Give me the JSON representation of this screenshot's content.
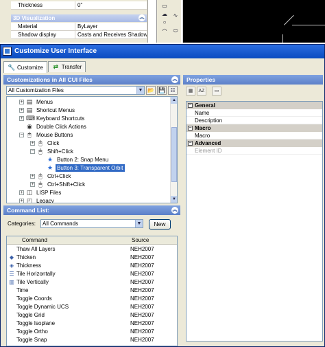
{
  "background": {
    "properties": [
      {
        "key": "Thickness",
        "value": "0\""
      },
      {
        "key": "Material",
        "value": "ByLayer"
      },
      {
        "key": "Shadow display",
        "value": "Casts and Receives Shadows"
      }
    ],
    "section_title": "3D Visualization",
    "tools": [
      "rectangle-icon",
      "cloud-icon",
      "circle-icon",
      "arc-icon",
      "spline-icon",
      "ellipse-icon"
    ]
  },
  "dialog": {
    "title": "Customize User Interface",
    "tabs": [
      {
        "label": "Customize",
        "icon": "wrench-icon",
        "active": true
      },
      {
        "label": "Transfer",
        "icon": "swap-arrows-icon",
        "active": false
      }
    ]
  },
  "customizations": {
    "header": "Customizations in All CUI Files",
    "combo_value": "All Customization Files",
    "tree": [
      {
        "label": "Menus",
        "icon": "menu-icon",
        "expander": "+",
        "indent": 0
      },
      {
        "label": "Shortcut Menus",
        "icon": "shortcut-menu-icon",
        "expander": "+",
        "indent": 0
      },
      {
        "label": "Keyboard Shortcuts",
        "icon": "keyboard-icon",
        "expander": "+",
        "indent": 0
      },
      {
        "label": "Double Click Actions",
        "icon": "double-click-icon",
        "expander": "",
        "indent": 0
      },
      {
        "label": "Mouse Buttons",
        "icon": "mouse-icon",
        "expander": "-",
        "indent": 0
      },
      {
        "label": "Click",
        "icon": "mouse-icon",
        "expander": "+",
        "indent": 1
      },
      {
        "label": "Shift+Click",
        "icon": "mouse-icon",
        "expander": "-",
        "indent": 1
      },
      {
        "label": "Button 2: Snap Menu",
        "icon": "star-icon",
        "expander": "",
        "indent": 2
      },
      {
        "label": "Button 3: Transparent Orbit",
        "icon": "star-icon",
        "expander": "",
        "indent": 2,
        "selected": true
      },
      {
        "label": "Ctrl+Click",
        "icon": "mouse-icon",
        "expander": "+",
        "indent": 1
      },
      {
        "label": "Ctrl+Shift+Click",
        "icon": "mouse-icon",
        "expander": "+",
        "indent": 1
      },
      {
        "label": "LISP Files",
        "icon": "lisp-icon",
        "expander": "+",
        "indent": 0
      },
      {
        "label": "Legacy",
        "icon": "legacy-icon",
        "expander": "+",
        "indent": 0
      }
    ]
  },
  "command_list": {
    "header": "Command List:",
    "categories_label": "Categories:",
    "categories_value": "All Commands",
    "new_button": "New",
    "columns": [
      "Command",
      "Source"
    ],
    "rows": [
      {
        "command": "Thaw All Layers",
        "source": "NEH2007",
        "icon": ""
      },
      {
        "command": "Thicken",
        "source": "NEH2007",
        "icon": "thicken-icon"
      },
      {
        "command": "Thickness",
        "source": "NEH2007",
        "icon": "thickness-icon"
      },
      {
        "command": "Tile Horizontally",
        "source": "NEH2007",
        "icon": "tile-horizontal-icon"
      },
      {
        "command": "Tile Vertically",
        "source": "NEH2007",
        "icon": "tile-vertical-icon"
      },
      {
        "command": "Time",
        "source": "NEH2007",
        "icon": ""
      },
      {
        "command": "Toggle Coords",
        "source": "NEH2007",
        "icon": ""
      },
      {
        "command": "Toggle Dynamic UCS",
        "source": "NEH2007",
        "icon": ""
      },
      {
        "command": "Toggle Grid",
        "source": "NEH2007",
        "icon": ""
      },
      {
        "command": "Toggle Isoplane",
        "source": "NEH2007",
        "icon": ""
      },
      {
        "command": "Toggle Ortho",
        "source": "NEH2007",
        "icon": ""
      },
      {
        "command": "Toggle Snap",
        "source": "NEH2007",
        "icon": ""
      }
    ]
  },
  "properties": {
    "header": "Properties",
    "grid": [
      {
        "type": "category",
        "label": "General"
      },
      {
        "type": "row",
        "label": "Name"
      },
      {
        "type": "row",
        "label": "Description"
      },
      {
        "type": "category",
        "label": "Macro"
      },
      {
        "type": "row",
        "label": "Macro"
      },
      {
        "type": "category",
        "label": "Advanced"
      },
      {
        "type": "row",
        "label": "Element ID",
        "dim": true
      }
    ]
  }
}
